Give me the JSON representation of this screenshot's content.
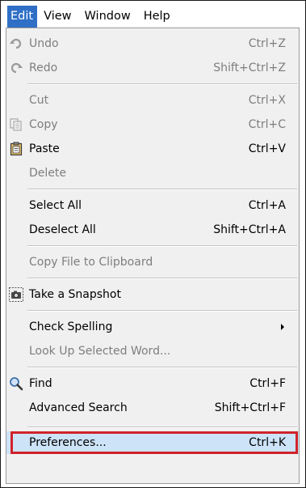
{
  "menubar": {
    "items": [
      {
        "label": "Edit",
        "active": true
      },
      {
        "label": "View"
      },
      {
        "label": "Window"
      },
      {
        "label": "Help"
      }
    ]
  },
  "menu": {
    "undo": {
      "label": "Undo",
      "shortcut": "Ctrl+Z",
      "icon": "undo-icon"
    },
    "redo": {
      "label": "Redo",
      "shortcut": "Shift+Ctrl+Z",
      "icon": "redo-icon"
    },
    "cut": {
      "label": "Cut",
      "shortcut": "Ctrl+X"
    },
    "copy": {
      "label": "Copy",
      "shortcut": "Ctrl+C",
      "icon": "copy-icon"
    },
    "paste": {
      "label": "Paste",
      "shortcut": "Ctrl+V",
      "icon": "paste-icon"
    },
    "delete": {
      "label": "Delete"
    },
    "select_all": {
      "label": "Select All",
      "shortcut": "Ctrl+A"
    },
    "deselect_all": {
      "label": "Deselect All",
      "shortcut": "Shift+Ctrl+A"
    },
    "copy_file": {
      "label": "Copy File to Clipboard"
    },
    "snapshot": {
      "label": "Take a Snapshot",
      "icon": "camera-icon"
    },
    "check_spelling": {
      "label": "Check Spelling"
    },
    "look_up": {
      "label": "Look Up Selected Word..."
    },
    "find": {
      "label": "Find",
      "shortcut": "Ctrl+F",
      "icon": "magnifier-icon"
    },
    "advanced_search": {
      "label": "Advanced Search",
      "shortcut": "Shift+Ctrl+F"
    },
    "preferences": {
      "label": "Preferences...",
      "shortcut": "Ctrl+K"
    }
  },
  "colors": {
    "menubar_active": "#2f6fc6",
    "panel_bg": "#f0f0f0",
    "disabled_text": "#7e7e7e",
    "selected_bg": "#cde3f7",
    "highlight_border": "#d0232a"
  }
}
